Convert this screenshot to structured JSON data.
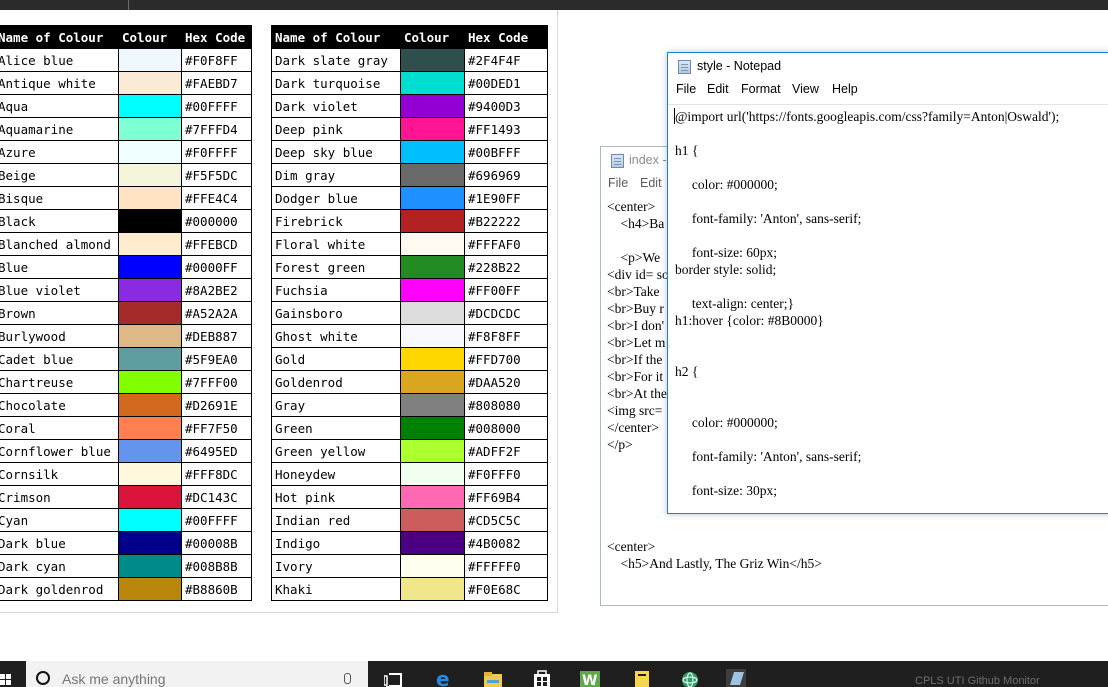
{
  "colour_table": {
    "headers": [
      "Name of Colour",
      "Colour",
      "Hex Code"
    ],
    "left_rows": [
      {
        "name": "Alice blue",
        "swatch": "#F0F8FF",
        "hex": "#F0F8FF"
      },
      {
        "name": "Antique white",
        "swatch": "#FAEBD7",
        "hex": "#FAEBD7"
      },
      {
        "name": "Aqua",
        "swatch": "#00FFFF",
        "hex": "#00FFFF"
      },
      {
        "name": "Aquamarine",
        "swatch": "#7FFFD4",
        "hex": "#7FFFD4"
      },
      {
        "name": "Azure",
        "swatch": "#F0FFFF",
        "hex": "#F0FFFF"
      },
      {
        "name": "Beige",
        "swatch": "#F5F5DC",
        "hex": "#F5F5DC"
      },
      {
        "name": "Bisque",
        "swatch": "#FFE4C4",
        "hex": "#FFE4C4"
      },
      {
        "name": "Black",
        "swatch": "#000000",
        "hex": "#000000"
      },
      {
        "name": "Blanched almond",
        "swatch": "#FFEBCD",
        "hex": "#FFEBCD"
      },
      {
        "name": "Blue",
        "swatch": "#0000FF",
        "hex": "#0000FF"
      },
      {
        "name": "Blue violet",
        "swatch": "#8A2BE2",
        "hex": "#8A2BE2"
      },
      {
        "name": "Brown",
        "swatch": "#A52A2A",
        "hex": "#A52A2A"
      },
      {
        "name": "Burlywood",
        "swatch": "#DEB887",
        "hex": "#DEB887"
      },
      {
        "name": "Cadet blue",
        "swatch": "#5F9EA0",
        "hex": "#5F9EA0"
      },
      {
        "name": "Chartreuse",
        "swatch": "#7FFF00",
        "hex": "#7FFF00"
      },
      {
        "name": "Chocolate",
        "swatch": "#D2691E",
        "hex": "#D2691E"
      },
      {
        "name": "Coral",
        "swatch": "#FF7F50",
        "hex": "#FF7F50"
      },
      {
        "name": "Cornflower blue",
        "swatch": "#6495ED",
        "hex": "#6495ED"
      },
      {
        "name": "Cornsilk",
        "swatch": "#FFF8DC",
        "hex": "#FFF8DC"
      },
      {
        "name": "Crimson",
        "swatch": "#DC143C",
        "hex": "#DC143C"
      },
      {
        "name": "Cyan",
        "swatch": "#00FFFF",
        "hex": "#00FFFF"
      },
      {
        "name": "Dark blue",
        "swatch": "#00008B",
        "hex": "#00008B"
      },
      {
        "name": "Dark cyan",
        "swatch": "#008B8B",
        "hex": "#008B8B"
      },
      {
        "name": "Dark goldenrod",
        "swatch": "#B8860B",
        "hex": "#B8860B"
      }
    ],
    "right_rows": [
      {
        "name": "Dark slate gray",
        "swatch": "#2F4F4F",
        "hex": "#2F4F4F"
      },
      {
        "name": "Dark turquoise",
        "swatch": "#00DED1",
        "hex": "#00DED1"
      },
      {
        "name": "Dark violet",
        "swatch": "#9400D3",
        "hex": "#9400D3"
      },
      {
        "name": "Deep pink",
        "swatch": "#FF1493",
        "hex": "#FF1493"
      },
      {
        "name": "Deep sky blue",
        "swatch": "#00BFFF",
        "hex": "#00BFFF"
      },
      {
        "name": "Dim gray",
        "swatch": "#696969",
        "hex": "#696969"
      },
      {
        "name": "Dodger blue",
        "swatch": "#1E90FF",
        "hex": "#1E90FF"
      },
      {
        "name": "Firebrick",
        "swatch": "#B22222",
        "hex": "#B22222"
      },
      {
        "name": "Floral white",
        "swatch": "#FFFAF0",
        "hex": "#FFFAF0"
      },
      {
        "name": "Forest green",
        "swatch": "#228B22",
        "hex": "#228B22"
      },
      {
        "name": "Fuchsia",
        "swatch": "#FF00FF",
        "hex": "#FF00FF"
      },
      {
        "name": "Gainsboro",
        "swatch": "#DCDCDC",
        "hex": "#DCDCDC"
      },
      {
        "name": "Ghost white",
        "swatch": "#F8F8FF",
        "hex": "#F8F8FF"
      },
      {
        "name": "Gold",
        "swatch": "#FFD700",
        "hex": "#FFD700"
      },
      {
        "name": "Goldenrod",
        "swatch": "#DAA520",
        "hex": "#DAA520"
      },
      {
        "name": "Gray",
        "swatch": "#808080",
        "hex": "#808080"
      },
      {
        "name": "Green",
        "swatch": "#008000",
        "hex": "#008000"
      },
      {
        "name": "Green yellow",
        "swatch": "#ADFF2F",
        "hex": "#ADFF2F"
      },
      {
        "name": "Honeydew",
        "swatch": "#F0FFF0",
        "hex": "#F0FFF0"
      },
      {
        "name": "Hot pink",
        "swatch": "#FF69B4",
        "hex": "#FF69B4"
      },
      {
        "name": "Indian red",
        "swatch": "#CD5C5C",
        "hex": "#CD5C5C"
      },
      {
        "name": "Indigo",
        "swatch": "#4B0082",
        "hex": "#4B0082"
      },
      {
        "name": "Ivory",
        "swatch": "#FFFFF0",
        "hex": "#FFFFF0"
      },
      {
        "name": "Khaki",
        "swatch": "#F0E68C",
        "hex": "#F0E68C"
      }
    ]
  },
  "index_notepad": {
    "title": "index -",
    "menu": [
      "File",
      "Edit"
    ],
    "lines": [
      "<center>",
      "    <h4>Ba",
      "",
      "    <p>We",
      "<div id= so",
      "<br>Take",
      "<br>Buy r",
      "<br>I don'",
      "<br>Let m",
      "<br>If the",
      "<br>For it",
      "<br>At the",
      "<img src=",
      "</center>",
      "</p>",
      "",
      "",
      "",
      "",
      "",
      "<center>",
      "    <h5>And Lastly, The Griz Win</h5>"
    ]
  },
  "style_notepad": {
    "title": "style - Notepad",
    "menu": [
      "File",
      "Edit",
      "Format",
      "View",
      "Help"
    ],
    "lines": [
      "@import url('https://fonts.googleapis.com/css?family=Anton|Oswald');",
      "",
      "h1 {",
      "",
      "     color: #000000;",
      "",
      "     font-family: 'Anton', sans-serif;",
      "",
      "     font-size: 60px;",
      "border style: solid;",
      "",
      "     text-align: center;}",
      "h1:hover {color: #8B0000}",
      "",
      "",
      "h2 {",
      "",
      "",
      "     color: #000000;",
      "",
      "     font-family: 'Anton', sans-serif;",
      "",
      "     font-size: 30px;"
    ]
  },
  "taskbar": {
    "search_placeholder": "Ask me anything",
    "tray_text": "CPLS       UTI     Github Monitor",
    "icons": [
      "task-view-icon",
      "edge-icon",
      "file-explorer-icon",
      "store-icon",
      "w-app-icon",
      "sticky-notes-icon",
      "atom-icon",
      "notepad-icon"
    ]
  }
}
